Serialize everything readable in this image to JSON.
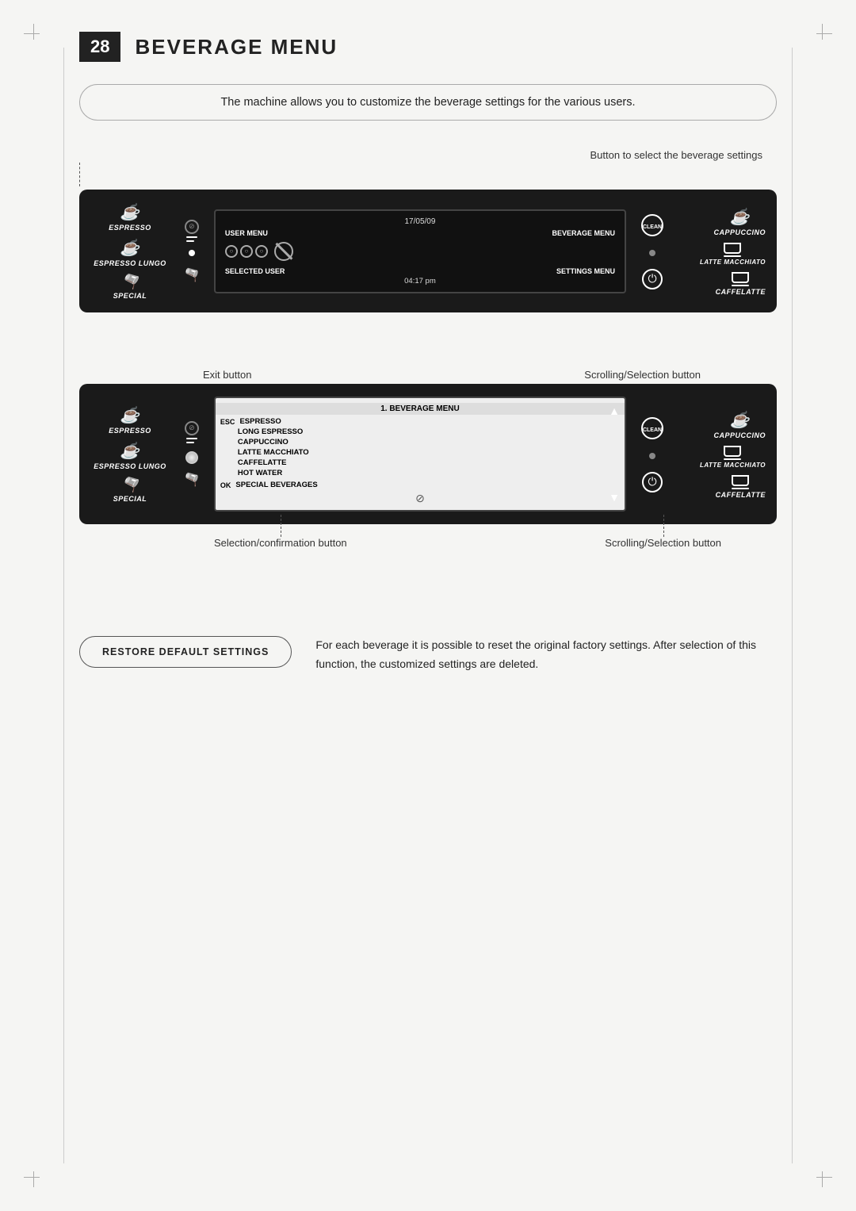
{
  "page": {
    "number": "28",
    "title": "BEVERAGE MENU"
  },
  "intro": {
    "text": "The machine allows you to customize the beverage settings for the various users."
  },
  "top_annotation": {
    "label": "Button to select the beverage settings"
  },
  "machine1": {
    "date": "17/05/09",
    "user_menu": "USER\nMENU",
    "beverage_menu": "BEVERAGE\nMENU",
    "selected_user": "SELECTED\nUSER",
    "settings_menu": "SETTINGS\nMENU",
    "time": "04:17 pm",
    "clean_label": "CLEAN",
    "beverages_left": [
      "ESPRESSO",
      "ESPRESSO LUNGO",
      "SPECIAL"
    ],
    "beverages_right": [
      "CAPPUCCINO",
      "LATTE MACCHIATO",
      "CAFFELATTE"
    ]
  },
  "machine2": {
    "menu_title": "1. BEVERAGE MENU",
    "esc_label": "ESC",
    "ok_label": "OK",
    "clean_label": "CLEAN",
    "items": [
      "ESPRESSO",
      "LONG ESPRESSO",
      "CAPPUCCINO",
      "LATTE MACCHIATO",
      "CAFFELATTE",
      "HOT WATER",
      "SPECIAL BEVERAGES"
    ],
    "beverages_left": [
      "ESPRESSO",
      "ESPRESSO LUNGO",
      "SPECIAL"
    ],
    "beverages_right": [
      "CAPPUCCINO",
      "LATTE MACCHIATO",
      "CAFFELATTE"
    ]
  },
  "annotations": {
    "exit_button": "Exit button",
    "scrolling_selection_top": "Scrolling/Selection button",
    "selection_confirmation": "Selection/confirmation button",
    "scrolling_selection_bottom": "Scrolling/Selection button"
  },
  "restore": {
    "button_label": "RESTORE DEFAULT SETTINGS",
    "description": "For each beverage it is possible to reset the original factory settings. After selection of this function, the customized settings are deleted."
  }
}
